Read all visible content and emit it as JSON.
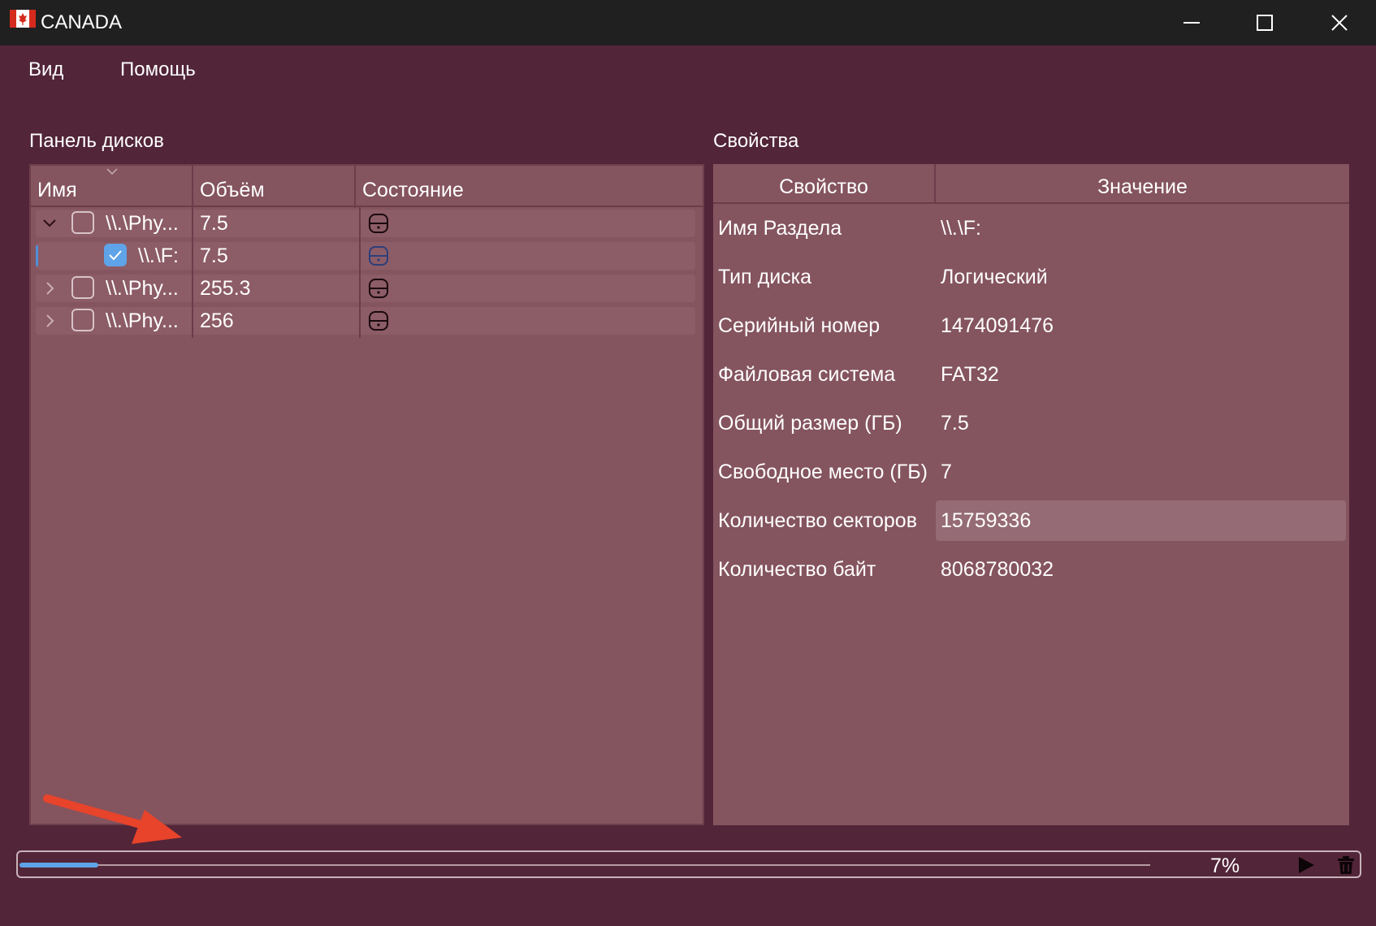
{
  "window": {
    "title": "CANADA",
    "controls": {
      "minimize": "minimize-icon",
      "maximize": "maximize-icon",
      "close": "close-icon"
    }
  },
  "menu": {
    "items": [
      "Вид",
      "Помощь"
    ]
  },
  "disk_panel": {
    "title": "Панель дисков",
    "columns": [
      "Имя",
      "Объём",
      "Состояние"
    ],
    "rows": [
      {
        "name": "\\\\.\\Phy...",
        "size": "7.5",
        "expanded": true,
        "checked": false,
        "level": 0
      },
      {
        "name": "\\\\.\\F:",
        "size": "7.5",
        "expanded": null,
        "checked": true,
        "level": 1,
        "selected": true
      },
      {
        "name": "\\\\.\\Phy...",
        "size": "255.3",
        "expanded": false,
        "checked": false,
        "level": 0
      },
      {
        "name": "\\\\.\\Phy...",
        "size": "256",
        "expanded": false,
        "checked": false,
        "level": 0
      }
    ]
  },
  "properties": {
    "title": "Свойства",
    "columns": [
      "Свойство",
      "Значение"
    ],
    "rows": [
      {
        "key": "Имя Раздела",
        "value": "\\\\.\\F:"
      },
      {
        "key": "Тип диска",
        "value": "Логический"
      },
      {
        "key": "Серийный номер",
        "value": "1474091476"
      },
      {
        "key": "Файловая система",
        "value": "FAT32"
      },
      {
        "key": "Общий размер (ГБ)",
        "value": "7.5"
      },
      {
        "key": "Свободное место (ГБ)",
        "value": "7"
      },
      {
        "key": "Количество секторов",
        "value": "15759336"
      },
      {
        "key": "Количество байт",
        "value": "8068780032"
      }
    ]
  },
  "progress": {
    "label": "7%",
    "value_percent": 7
  },
  "colors": {
    "background": "#522538",
    "panel": "#84545f",
    "accent": "#5fa3e8",
    "titlebar": "#202020",
    "annotation_arrow": "#e8432b"
  }
}
